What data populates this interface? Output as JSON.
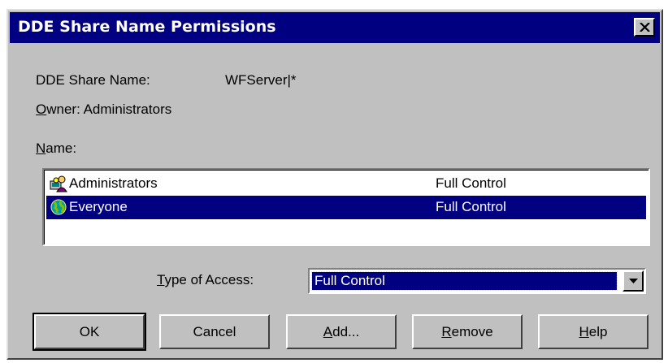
{
  "window": {
    "title": "DDE Share Name Permissions",
    "close_icon": "close-x-icon"
  },
  "share": {
    "name_label": "DDE Share Name:",
    "name_value": "WFServer|*",
    "owner_label_prefix": "O",
    "owner_label_rest": "wner: Administrators"
  },
  "name_list": {
    "label_prefix": "N",
    "label_rest": "ame:",
    "items": [
      {
        "name": "Administrators",
        "access": "Full Control",
        "icon": "user-group-icon",
        "selected": false
      },
      {
        "name": "Everyone",
        "access": "Full Control",
        "icon": "globe-icon",
        "selected": true
      }
    ]
  },
  "access": {
    "label_prefix": "T",
    "label_rest": "ype of Access:",
    "selected": "Full Control"
  },
  "buttons": {
    "ok": "OK",
    "cancel": "Cancel",
    "add_prefix": "A",
    "add_rest": "dd...",
    "remove_prefix": "R",
    "remove_rest": "emove",
    "help_prefix": "H",
    "help_rest": "elp"
  },
  "colors": {
    "titlebar": "#000080",
    "face": "#c0c0c0",
    "selection": "#000080"
  }
}
